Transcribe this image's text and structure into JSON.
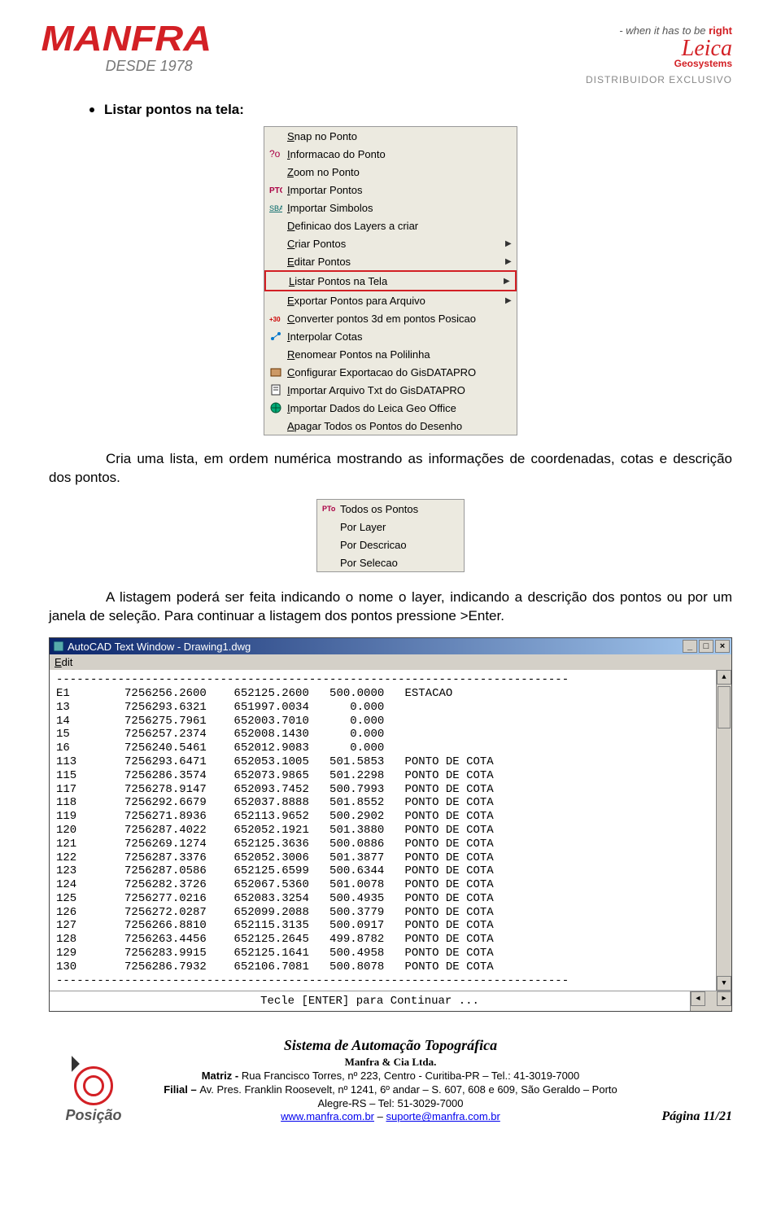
{
  "header": {
    "brand": "MANFRA",
    "since": "DESDE 1978",
    "tagline_pre": "- when it has to be ",
    "tagline_bold": "right",
    "partner": "Leica",
    "partner_sub": "Geosystems",
    "distributor": "DISTRIBUIDOR EXCLUSIVO"
  },
  "heading1": "Listar pontos na tela:",
  "menu1": {
    "items": [
      {
        "label": "Snap no Ponto",
        "u": "S",
        "rest": "nap no Ponto",
        "icon": "",
        "arrow": false
      },
      {
        "label": "Informacao do Ponto",
        "u": "I",
        "rest": "nformacao do Ponto",
        "icon": "info",
        "arrow": false
      },
      {
        "label": "Zoom no Ponto",
        "u": "Z",
        "rest": "oom no Ponto",
        "icon": "",
        "arrow": false
      },
      {
        "label": "Importar Pontos",
        "u": "I",
        "rest": "mportar Pontos",
        "icon": "folder",
        "arrow": false
      },
      {
        "label": "Importar Simbolos",
        "u": "I",
        "rest": "mportar Simbolos",
        "icon": "sba",
        "arrow": false
      },
      {
        "label": "Definicao dos Layers a criar",
        "u": "D",
        "rest": "efinicao dos Layers a criar",
        "icon": "",
        "arrow": false
      },
      {
        "label": "Criar Pontos",
        "u": "C",
        "rest": "riar Pontos",
        "icon": "",
        "arrow": true
      },
      {
        "label": "Editar Pontos",
        "u": "E",
        "rest": "ditar Pontos",
        "icon": "",
        "arrow": true
      },
      {
        "label": "Listar Pontos na Tela",
        "u": "L",
        "rest": "istar Pontos na Tela",
        "icon": "",
        "arrow": true,
        "hl": true
      },
      {
        "label": "Exportar Pontos para Arquivo",
        "u": "E",
        "rest": "xportar Pontos para Arquivo",
        "icon": "",
        "arrow": true
      },
      {
        "label": "Converter pontos 3d em pontos Posicao",
        "u": "C",
        "rest": "onverter pontos 3d em pontos Posicao",
        "icon": "conv",
        "arrow": false
      },
      {
        "label": "Interpolar Cotas",
        "u": "I",
        "rest": "nterpolar Cotas",
        "icon": "interp",
        "arrow": false
      },
      {
        "label": "Renomear Pontos na Polilinha",
        "u": "R",
        "rest": "enomear Pontos na Polilinha",
        "icon": "",
        "arrow": false
      },
      {
        "label": "Configurar Exportacao do GisDATAPRO",
        "u": "C",
        "rest": "onfigurar Exportacao do GisDATAPRO",
        "icon": "conf",
        "arrow": false
      },
      {
        "label": "Importar Arquivo Txt do GisDATAPRO",
        "u": "I",
        "rest": "mportar Arquivo Txt do GisDATAPRO",
        "icon": "txt",
        "arrow": false
      },
      {
        "label": "Importar Dados do Leica Geo Office",
        "u": "I",
        "rest": "mportar Dados do Leica Geo Office",
        "icon": "globe",
        "arrow": false
      },
      {
        "label": "Apagar Todos os Pontos do Desenho",
        "u": "A",
        "rest": "pagar Todos os Pontos do Desenho",
        "icon": "",
        "arrow": false
      }
    ]
  },
  "para1": "Cria uma lista, em ordem numérica mostrando as informações de coordenadas, cotas e descrição dos pontos.",
  "menu2": {
    "items": [
      {
        "u": "T",
        "rest": "odos os Pontos",
        "icon": "pto"
      },
      {
        "u": "P",
        "rest": "or Layer",
        "icon": ""
      },
      {
        "u": "P",
        "rest": "or Descricao",
        "icon": ""
      },
      {
        "u": "P",
        "rest": "or Selecao",
        "icon": ""
      }
    ]
  },
  "para2": "A listagem poderá ser feita indicando o nome o layer, indicando a descrição dos pontos ou por um janela de seleção. Para continuar a listagem dos pontos pressione >Enter.",
  "textwin": {
    "title": "AutoCAD Text Window - Drawing1.dwg",
    "edit": "Edit",
    "prompt": "Tecle [ENTER] para Continuar ...",
    "sep": "---------------------------------------------------------------------------",
    "rows": [
      [
        "E1",
        "7256256.2600",
        "652125.2600",
        "500.0000",
        "ESTACAO"
      ],
      [
        "13",
        "7256293.6321",
        "651997.0034",
        "0.000",
        ""
      ],
      [
        "14",
        "7256275.7961",
        "652003.7010",
        "0.000",
        ""
      ],
      [
        "15",
        "7256257.2374",
        "652008.1430",
        "0.000",
        ""
      ],
      [
        "16",
        "7256240.5461",
        "652012.9083",
        "0.000",
        ""
      ],
      [
        "113",
        "7256293.6471",
        "652053.1005",
        "501.5853",
        "PONTO DE COTA"
      ],
      [
        "115",
        "7256286.3574",
        "652073.9865",
        "501.2298",
        "PONTO DE COTA"
      ],
      [
        "117",
        "7256278.9147",
        "652093.7452",
        "500.7993",
        "PONTO DE COTA"
      ],
      [
        "118",
        "7256292.6679",
        "652037.8888",
        "501.8552",
        "PONTO DE COTA"
      ],
      [
        "119",
        "7256271.8936",
        "652113.9652",
        "500.2902",
        "PONTO DE COTA"
      ],
      [
        "120",
        "7256287.4022",
        "652052.1921",
        "501.3880",
        "PONTO DE COTA"
      ],
      [
        "121",
        "7256269.1274",
        "652125.3636",
        "500.0886",
        "PONTO DE COTA"
      ],
      [
        "122",
        "7256287.3376",
        "652052.3006",
        "501.3877",
        "PONTO DE COTA"
      ],
      [
        "123",
        "7256287.0586",
        "652125.6599",
        "500.6344",
        "PONTO DE COTA"
      ],
      [
        "124",
        "7256282.3726",
        "652067.5360",
        "501.0078",
        "PONTO DE COTA"
      ],
      [
        "125",
        "7256277.0216",
        "652083.3254",
        "500.4935",
        "PONTO DE COTA"
      ],
      [
        "126",
        "7256272.0287",
        "652099.2088",
        "500.3779",
        "PONTO DE COTA"
      ],
      [
        "127",
        "7256266.8810",
        "652115.3135",
        "500.0917",
        "PONTO DE COTA"
      ],
      [
        "128",
        "7256263.4456",
        "652125.2645",
        "499.8782",
        "PONTO DE COTA"
      ],
      [
        "129",
        "7256283.9915",
        "652125.1641",
        "500.4958",
        "PONTO DE COTA"
      ],
      [
        "130",
        "7256286.7932",
        "652106.7081",
        "500.8078",
        "PONTO DE COTA"
      ]
    ]
  },
  "footer": {
    "posicao": "Posição",
    "system": "Sistema de Automação Topográfica",
    "company": "Manfra & Cia Ltda.",
    "matriz_lbl": "Matriz - ",
    "matriz": "Rua Francisco Torres, nº 223, Centro - Curitiba-PR – Tel.: 41-3019-7000",
    "filial_lbl": "Filial – ",
    "filial": "Av. Pres. Franklin Roosevelt, nº 1241, 6º andar – S. 607, 608 e 609,  São Geraldo – Porto Alegre-RS – Tel: 51-3029-7000",
    "url1": "www.manfra.com.br",
    "dash": " – ",
    "url2": "suporte@manfra.com.br",
    "page": "Página 11/21"
  }
}
